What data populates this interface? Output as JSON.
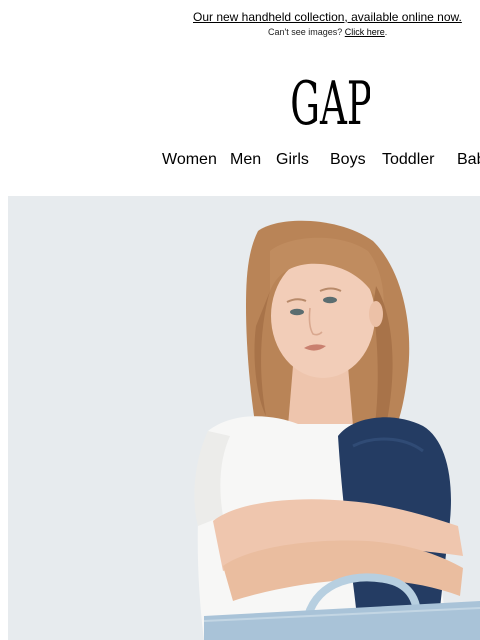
{
  "preheader": {
    "promo_link": "Our new handheld collection, available online now.",
    "cant_see_text": "Can't see images?",
    "click_here": "Click here",
    "period": "."
  },
  "logo": {
    "text": "GAP"
  },
  "nav": {
    "items": [
      {
        "label": "Women"
      },
      {
        "label": "Men"
      },
      {
        "label": "Girls"
      },
      {
        "label": "Boys"
      },
      {
        "label": "Toddler"
      },
      {
        "label": "Bab"
      }
    ]
  },
  "hero": {
    "alt": "Model in white tee and dark jeans sitting with a light denim bag"
  }
}
